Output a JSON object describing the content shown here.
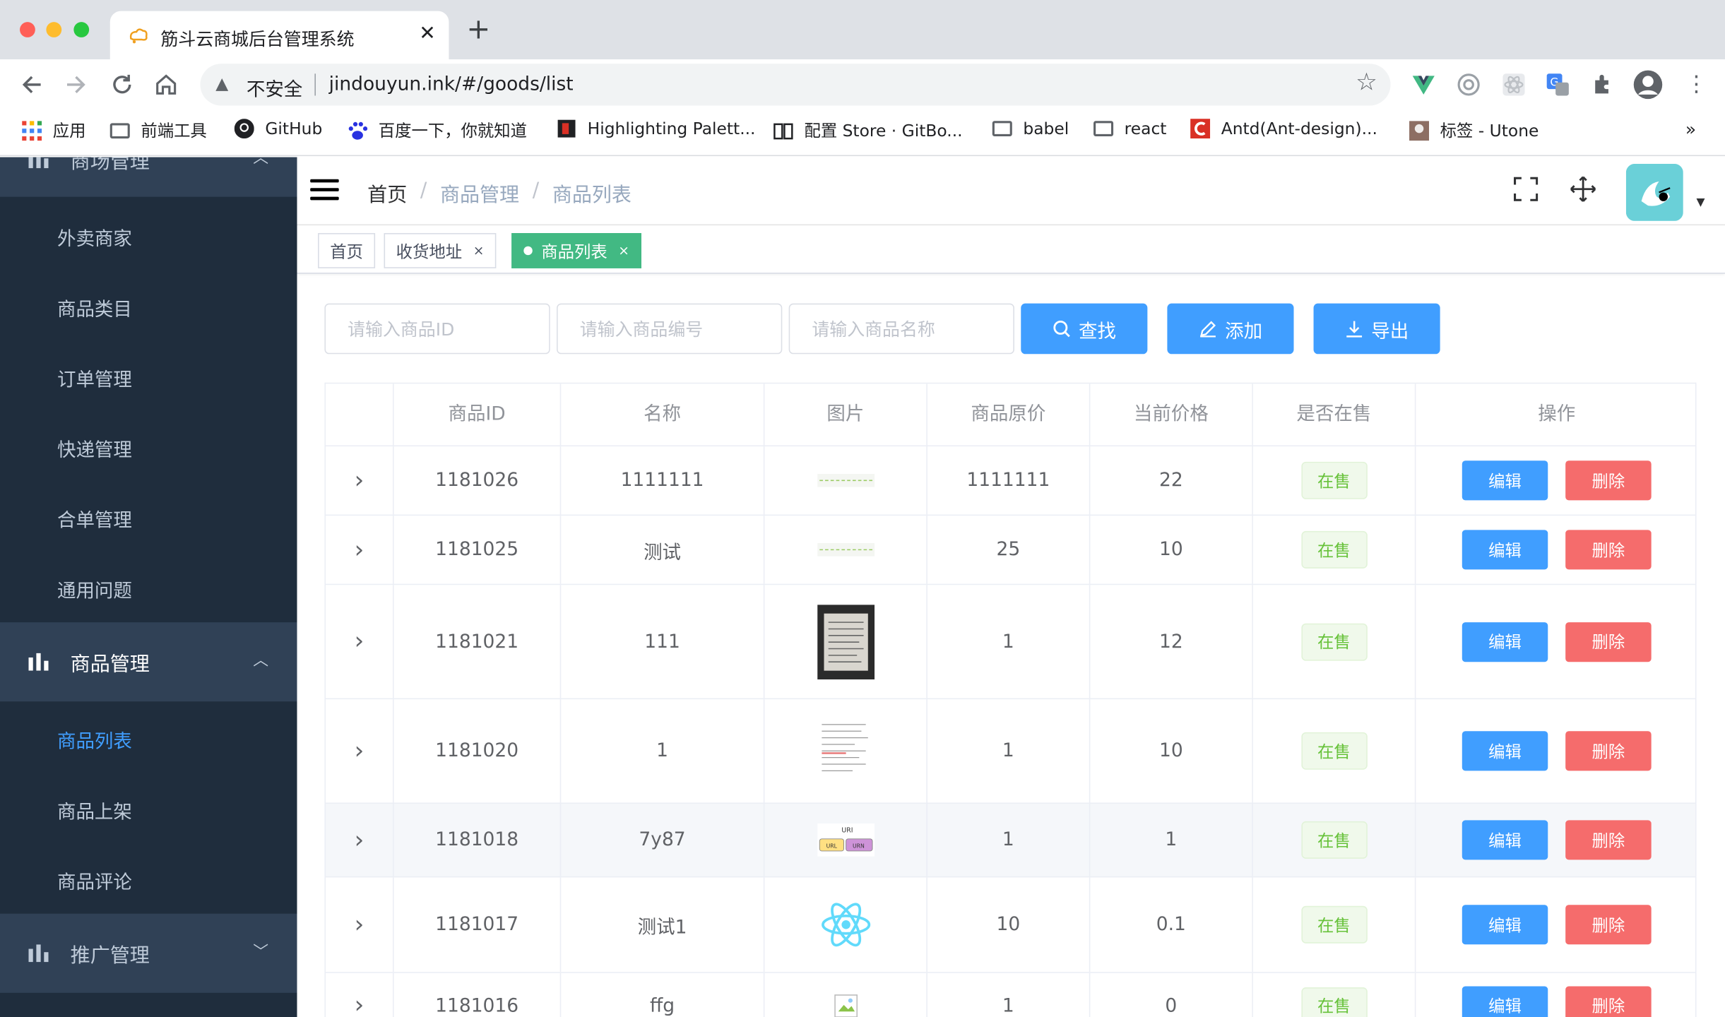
{
  "browser": {
    "tab_title": "筋斗云商城后台管理系统",
    "tab_close": "✕",
    "new_tab": "+",
    "insecure_label": "不安全",
    "url": "jindouyun.ink/#/goods/list",
    "bookmarks": [
      {
        "label": "应用",
        "icon": "apps-grid-icon"
      },
      {
        "label": "前端工具",
        "icon": "folder-icon"
      },
      {
        "label": "GitHub",
        "icon": "github-icon"
      },
      {
        "label": "百度一下，你就知道",
        "icon": "baidu-paw-icon"
      },
      {
        "label": "Highlighting Palett...",
        "icon": "page-icon"
      },
      {
        "label": "配置 Store · GitBo...",
        "icon": "book-icon"
      },
      {
        "label": "babel",
        "icon": "folder-icon"
      },
      {
        "label": "react",
        "icon": "folder-icon"
      },
      {
        "label": "Antd(Ant-design)...",
        "icon": "c-logo-icon"
      },
      {
        "label": "标签 - Utone",
        "icon": "avatar-icon"
      }
    ],
    "bookmarks_more": "»"
  },
  "sidebar": {
    "top_group": "商场管理",
    "top_items": [
      "外卖商家",
      "商品类目",
      "订单管理",
      "快递管理",
      "合单管理",
      "通用问题"
    ],
    "goods_group": "商品管理",
    "goods_items": [
      {
        "label": "商品列表",
        "active": true
      },
      {
        "label": "商品上架",
        "active": false
      },
      {
        "label": "商品评论",
        "active": false
      }
    ],
    "promo_group": "推广管理",
    "colors": {
      "bg": "#1f2d3d",
      "group_bg": "#304156",
      "active": "#409eff"
    }
  },
  "header": {
    "breadcrumb": [
      "首页",
      "商品管理",
      "商品列表"
    ],
    "breadcrumb_sep": "/"
  },
  "tags": [
    {
      "label": "首页",
      "closable": false,
      "active": false
    },
    {
      "label": "收货地址",
      "closable": true,
      "active": false
    },
    {
      "label": "商品列表",
      "closable": true,
      "active": true
    }
  ],
  "tag_close": "×",
  "filters": {
    "id_placeholder": "请输入商品ID",
    "code_placeholder": "请输入商品编号",
    "name_placeholder": "请输入商品名称",
    "search_label": "查找",
    "add_label": "添加",
    "export_label": "导出"
  },
  "table": {
    "columns": [
      "",
      "商品ID",
      "名称",
      "图片",
      "商品原价",
      "当前价格",
      "是否在售",
      "操作"
    ],
    "expand_glyph": "›",
    "rows": [
      {
        "id": "1181026",
        "name": "1111111",
        "image": "thin-strip",
        "orig": "1111111",
        "cur": "22",
        "status": "在售"
      },
      {
        "id": "1181025",
        "name": "测试",
        "image": "thin-strip",
        "orig": "25",
        "cur": "10",
        "status": "在售"
      },
      {
        "id": "1181021",
        "name": "111",
        "image": "dark-photo",
        "orig": "1",
        "cur": "12",
        "status": "在售"
      },
      {
        "id": "1181020",
        "name": "1",
        "image": "document",
        "orig": "1",
        "cur": "10",
        "status": "在售"
      },
      {
        "id": "1181018",
        "name": "7y87",
        "image": "uri-diagram",
        "orig": "1",
        "cur": "1",
        "status": "在售"
      },
      {
        "id": "1181017",
        "name": "测试1",
        "image": "react-logo",
        "orig": "10",
        "cur": "0.1",
        "status": "在售"
      },
      {
        "id": "1181016",
        "name": "ffg",
        "image": "broken",
        "orig": "1",
        "cur": "0",
        "status": "在售"
      }
    ],
    "edit_label": "编辑",
    "delete_label": "删除"
  },
  "colors": {
    "primary": "#409eff",
    "danger": "#f56c6c",
    "success": "#67c23a",
    "tag_active": "#42b983"
  }
}
